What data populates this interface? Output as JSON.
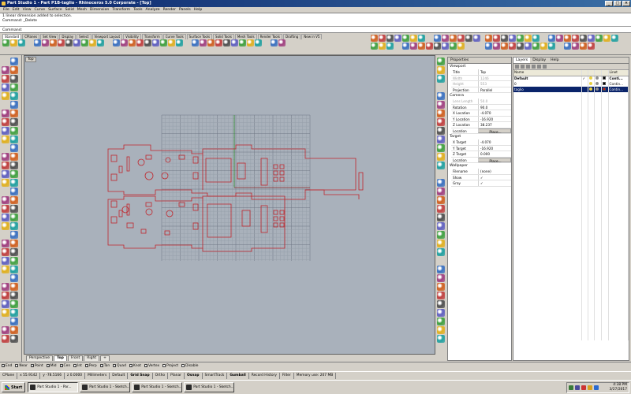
{
  "window": {
    "title": "Part Studio 1 - Part P1B-taglio - Rhinoceros 5.0 Corporate - [Top]"
  },
  "menu": [
    "File",
    "Edit",
    "View",
    "Curve",
    "Surface",
    "Solid",
    "Mesh",
    "Dimension",
    "Transform",
    "Tools",
    "Analyze",
    "Render",
    "Panels",
    "Help"
  ],
  "history": {
    "line1": "1 linear dimension added to selection.",
    "line2": "Command: _Delete"
  },
  "command": {
    "label": "Command:",
    "value": ""
  },
  "toolbar_tabs": [
    "Standard",
    "CPlanes",
    "Set View",
    "Display",
    "Select",
    "Viewport Layout",
    "Visibility",
    "Transform",
    "Curve Tools",
    "Surface Tools",
    "Solid Tools",
    "Mesh Tools",
    "Render Tools",
    "Drafting",
    "New in V5"
  ],
  "viewport": {
    "title": "Top",
    "tabs": [
      "Perspective",
      "Top",
      "Front",
      "Right"
    ],
    "active_tab": "Top",
    "add_tab": "+"
  },
  "properties": {
    "header": "Properties",
    "sections": [
      {
        "name": "Viewport",
        "rows": [
          {
            "k": "Title",
            "v": "Top",
            "disabled": false
          },
          {
            "k": "Width",
            "v": "1246",
            "disabled": true
          },
          {
            "k": "Height",
            "v": "553",
            "disabled": true
          },
          {
            "k": "Projection",
            "v": "Parallel",
            "disabled": false
          }
        ]
      },
      {
        "name": "Camera",
        "rows": [
          {
            "k": "Lens Length",
            "v": "50.0",
            "disabled": true
          },
          {
            "k": "Rotation",
            "v": "90.0",
            "disabled": false
          },
          {
            "k": "X Location",
            "v": "-4.070",
            "disabled": false
          },
          {
            "k": "Y Location",
            "v": "-16.920",
            "disabled": false
          },
          {
            "k": "Z Location",
            "v": "38.237",
            "disabled": false
          },
          {
            "k": "Location",
            "v": "Place...",
            "disabled": false,
            "button": true
          }
        ]
      },
      {
        "name": "Target",
        "rows": [
          {
            "k": "X Target",
            "v": "-4.070",
            "disabled": false
          },
          {
            "k": "Y Target",
            "v": "-16.920",
            "disabled": false
          },
          {
            "k": "Z Target",
            "v": "0.000",
            "disabled": false
          },
          {
            "k": "Location",
            "v": "Place...",
            "disabled": false,
            "button": true
          }
        ]
      },
      {
        "name": "Wallpaper",
        "rows": [
          {
            "k": "Filename",
            "v": "(none)",
            "disabled": false
          },
          {
            "k": "Show",
            "v": "✓",
            "disabled": false
          },
          {
            "k": "Gray",
            "v": "✓",
            "disabled": false
          }
        ]
      }
    ]
  },
  "layers": {
    "tabs": [
      "Layers",
      "Display",
      "Help"
    ],
    "columns": [
      "Name",
      "",
      "",
      "",
      "",
      "Linet"
    ],
    "rows": [
      {
        "name": "Default",
        "check": "✓",
        "lock": "",
        "color": "#000000",
        "material": "#000000",
        "linetype": "Conti...",
        "bold": true,
        "selected": false
      },
      {
        "name": "0",
        "check": "",
        "lock": "",
        "color": "#000000",
        "material": "#ffffff",
        "linetype": "Contin...",
        "bold": false,
        "selected": false
      },
      {
        "name": "taglio",
        "check": "",
        "lock": "",
        "color": "#d01010",
        "material": "#ffffff",
        "linetype": "Contin...",
        "bold": false,
        "selected": true
      }
    ]
  },
  "osnaps": [
    {
      "label": "End",
      "checked": true
    },
    {
      "label": "Near",
      "checked": true
    },
    {
      "label": "Point",
      "checked": true
    },
    {
      "label": "Mid",
      "checked": true
    },
    {
      "label": "Cen",
      "checked": true
    },
    {
      "label": "Int",
      "checked": true
    },
    {
      "label": "Perp",
      "checked": true
    },
    {
      "label": "Tan",
      "checked": true
    },
    {
      "label": "Quad",
      "checked": true
    },
    {
      "label": "Knot",
      "checked": true
    },
    {
      "label": "Vertex",
      "checked": true
    },
    {
      "label": "Project",
      "checked": false
    },
    {
      "label": "Disable",
      "checked": false
    }
  ],
  "status": {
    "cplane": "CPlane",
    "x": "x 55.9142",
    "y": "y -78.5166",
    "z": "z 0.0000",
    "units": "Millimeters",
    "layer": "Default",
    "grid_snap": "Grid Snap",
    "ortho": "Ortho",
    "planar": "Planar",
    "osnap": "Osnap",
    "smarttrack": "SmartTrack",
    "gumball": "Gumball",
    "record": "Record History",
    "filter": "Filter",
    "memory": "Memory use: 207 MB"
  },
  "taskbar": {
    "start": "Start",
    "tasks": [
      "Part Studio 1 - Par...",
      "Part Studio 1 - Sketch...",
      "Part Studio 1 - Sketch...",
      "Part Studio 1 - Sketch..."
    ],
    "time": "4:38 PM",
    "date": "3/27/2017",
    "tray_icons": [
      "network-icon",
      "volume-icon",
      "security-icon",
      "update-icon",
      "language-icon"
    ]
  },
  "colors": {
    "viewport_bg": "#a9b1bb",
    "grid_minor": "#97a0ab",
    "grid_major": "#6e7784",
    "geometry": "#c0262c",
    "x_axis": "#8c2a2a",
    "y_axis": "#2a8a2a",
    "title_gradient_start": "#0a246a",
    "title_gradient_end": "#3a6ea5",
    "selection": "#0a246a"
  }
}
